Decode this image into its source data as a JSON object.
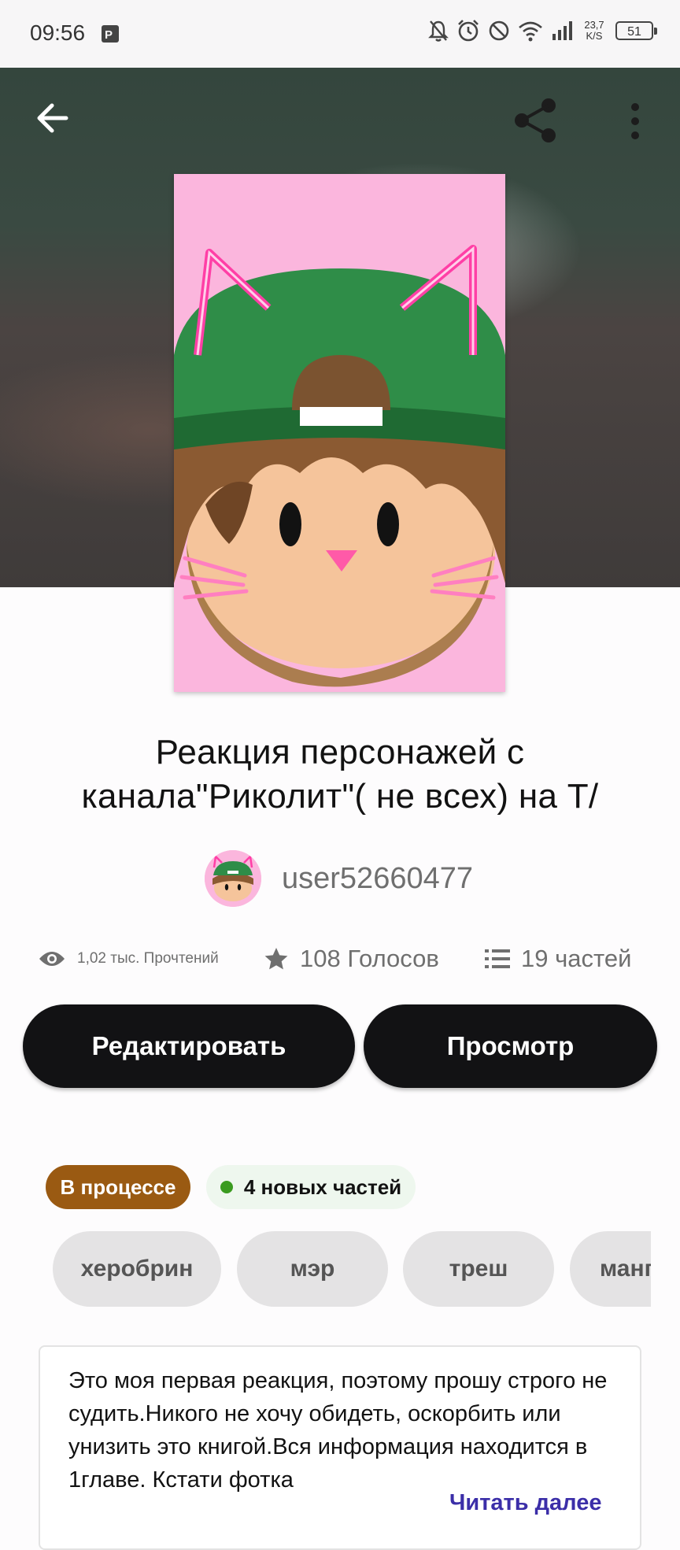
{
  "status_bar": {
    "time": "09:56",
    "net_speed_value": "23,7",
    "net_speed_unit": "K/S",
    "battery": "51",
    "icons": [
      "app-p-icon",
      "mute-bell-icon",
      "alarm-icon",
      "do-not-disturb-icon",
      "wifi-icon",
      "signal-icon",
      "battery-icon"
    ]
  },
  "header": {
    "back_icon": "arrow-left-icon",
    "share_icon": "share-icon",
    "more_icon": "more-vertical-icon"
  },
  "story": {
    "title_line1": "Реакция персонажей с",
    "title_line2": "канала\"Риколит\"( не всех) на Т/",
    "author": "user52660477",
    "stats": {
      "reads": "1,02 тыс. Прочтений",
      "votes": "108 Голосов",
      "parts": "19 частей"
    }
  },
  "actions": {
    "edit_label": "Редактировать",
    "view_label": "Просмотр"
  },
  "status_badges": {
    "progress_label": "В процессе",
    "new_parts_label": "4 новых частей"
  },
  "tags": [
    "херобрин",
    "мэр",
    "треш",
    "манга"
  ],
  "description": {
    "text": "Это моя первая реакция, поэтому прошу строго не судить.Никого не хочу обидеть, оскорбить или унизить это книгой.Вся информация находится в 1главе. Кстати фотка",
    "read_more_label": "Читать далее"
  },
  "colors": {
    "progress_badge": "#9a5a12",
    "new_dot": "#3a9b1f",
    "button_bg": "#121214",
    "cover_bg": "#fbb6dd",
    "link": "#3b2ea8"
  }
}
